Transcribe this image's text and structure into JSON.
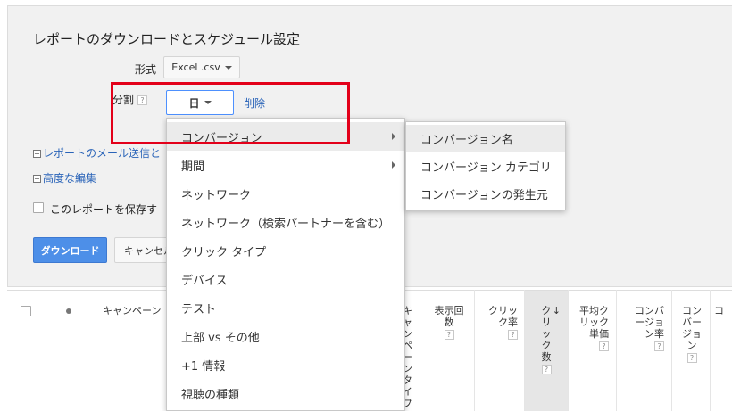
{
  "title": "レポートのダウンロードとスケジュール設定",
  "format": {
    "label": "形式",
    "value": "Excel .csv"
  },
  "segment": {
    "label": "分割",
    "help": "?",
    "value": "日",
    "delete": "削除"
  },
  "links": {
    "email": "レポートのメール送信と",
    "advanced": "高度な編集"
  },
  "save_report_label": "このレポートを保存す",
  "buttons": {
    "download": "ダウンロード",
    "cancel": "キャンセル"
  },
  "dropdown": {
    "items": [
      {
        "label": "コンバージョン",
        "submenu": true,
        "active": true
      },
      {
        "label": "期間",
        "submenu": true
      },
      {
        "label": "ネットワーク"
      },
      {
        "label": "ネットワーク（検索パートナーを含む）"
      },
      {
        "label": "クリック タイプ"
      },
      {
        "label": "デバイス"
      },
      {
        "label": "テスト"
      },
      {
        "label": "上部 vs その他"
      },
      {
        "label": "+1 情報"
      },
      {
        "label": "視聴の種類"
      }
    ]
  },
  "submenu": {
    "items": [
      {
        "label": "コンバージョン名",
        "active": true
      },
      {
        "label": "コンバージョン カテゴリ"
      },
      {
        "label": "コンバージョンの発生元"
      }
    ]
  },
  "table": {
    "campaign_header": "キャンペーン",
    "partial_header": "キャンペーンタイプ",
    "columns": [
      {
        "label": "表示回数",
        "help": "?"
      },
      {
        "label": "クリック率",
        "help": "?"
      },
      {
        "label": "クリック数",
        "help": "?",
        "sorted": true,
        "sort_icon": "↓"
      },
      {
        "label": "平均クリック単価",
        "help": "?"
      },
      {
        "label": "コンバージョン率",
        "help": "?"
      },
      {
        "label": "コンバージョン",
        "help": "?"
      },
      {
        "label": "コ"
      }
    ]
  }
}
